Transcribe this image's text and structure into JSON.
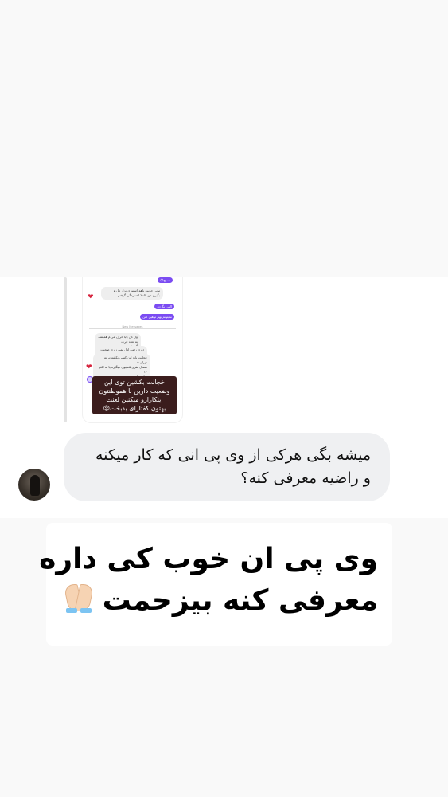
{
  "reply_thumbnail": {
    "top_badge": "نسيح😊",
    "gray_1": "تونی جونت باهم استوری بزار ما رو\nبگیرم من کاملا افسردگی گرفتم",
    "purple_1": "الهی بگردم",
    "purple_2": "نمیتونم بهم توهین کنن",
    "new_messages": "New Messages",
    "gray_2": "ول کن بابا حرف مردم همیشه یه عده چرت\nگو ها هستن",
    "gray_3": "داری رفتی اول نمی زاری صحبت بزنیم",
    "gray_4": "خجالت باید این کسی بکشه ترانه تهران ۵\nشمال نفری ۵ملیون میگیره یا به اکثر ۱۲\nمیلیون اجازه میده",
    "highlight_text": "خجالت بکشین توی این\nوضعیت دارین با هموطنتون\nاینکارارو میکنین لعنت\nبهتون کفتارای بدبخت😡",
    "heart_icon": "heart-icon"
  },
  "message": {
    "line_1": "میشه بگی هرکی از وی پی انی که کار میکنه",
    "line_2": "و راضیه معرفی کنه؟"
  },
  "caption": {
    "line_1": "وی پی ان خوب کی داره",
    "line_2": "معرفی کنه بیزحمت",
    "emoji_icon": "folded-hands-icon"
  }
}
